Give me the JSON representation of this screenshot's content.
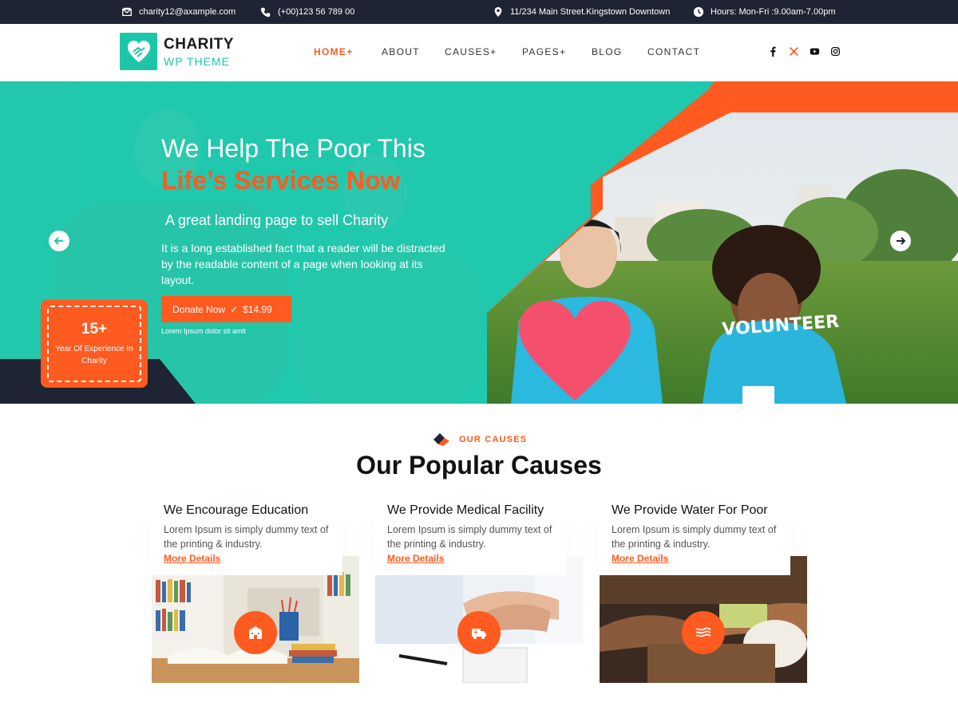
{
  "topbar": {
    "email": "charity12@axample.com",
    "phone": "(+00)123 56 789 00",
    "address": "11/234 Main Street.Kingstown Downtown",
    "hours": "Hours: Mon-Fri :9.00am-7.00pm"
  },
  "logo": {
    "line1": "CHARITY",
    "line2": "WP THEME"
  },
  "nav": {
    "items": [
      "HOME+",
      "ABOUT",
      "CAUSES+",
      "PAGES+",
      "BLOG",
      "CONTACT"
    ],
    "active": "HOME+"
  },
  "socials": [
    "facebook-icon",
    "x-icon",
    "youtube-icon",
    "instagram-icon"
  ],
  "hero": {
    "title_line1": "We Help The Poor This",
    "title_line2": "Life’s Services Now",
    "subtitle": "A great landing page to sell Charity",
    "description": "It is a long established fact that a reader will be distracted by the readable content of a page when looking at its layout.",
    "donate_label": "Donate Now",
    "donate_amount": "$14.99",
    "small_text": "Lorem Ipsum dolor sit amit",
    "shirt_text": "VOLUNTEER",
    "experience_number": "15+",
    "experience_label": "Year Of Experience In Charity"
  },
  "causes": {
    "tag": "OUR CAUSES",
    "title": "Our Popular Causes",
    "cards": [
      {
        "title": "We Encourage Education",
        "description": "Lorem Ipsum is simply dummy text of the printing & industry.",
        "link": "More Details",
        "icon": "school-icon"
      },
      {
        "title": "We Provide Medical Facility",
        "description": "Lorem Ipsum is simply dummy text of the printing & industry.",
        "link": "More Details",
        "icon": "ambulance-icon"
      },
      {
        "title": "We Provide Water For Poor",
        "description": "Lorem Ipsum is simply dummy text of the printing & industry.",
        "link": "More Details",
        "icon": "water-icon"
      }
    ]
  },
  "colors": {
    "accent": "#ff5a1f",
    "brand": "#1ec6a9",
    "topbar": "#1e2433"
  }
}
